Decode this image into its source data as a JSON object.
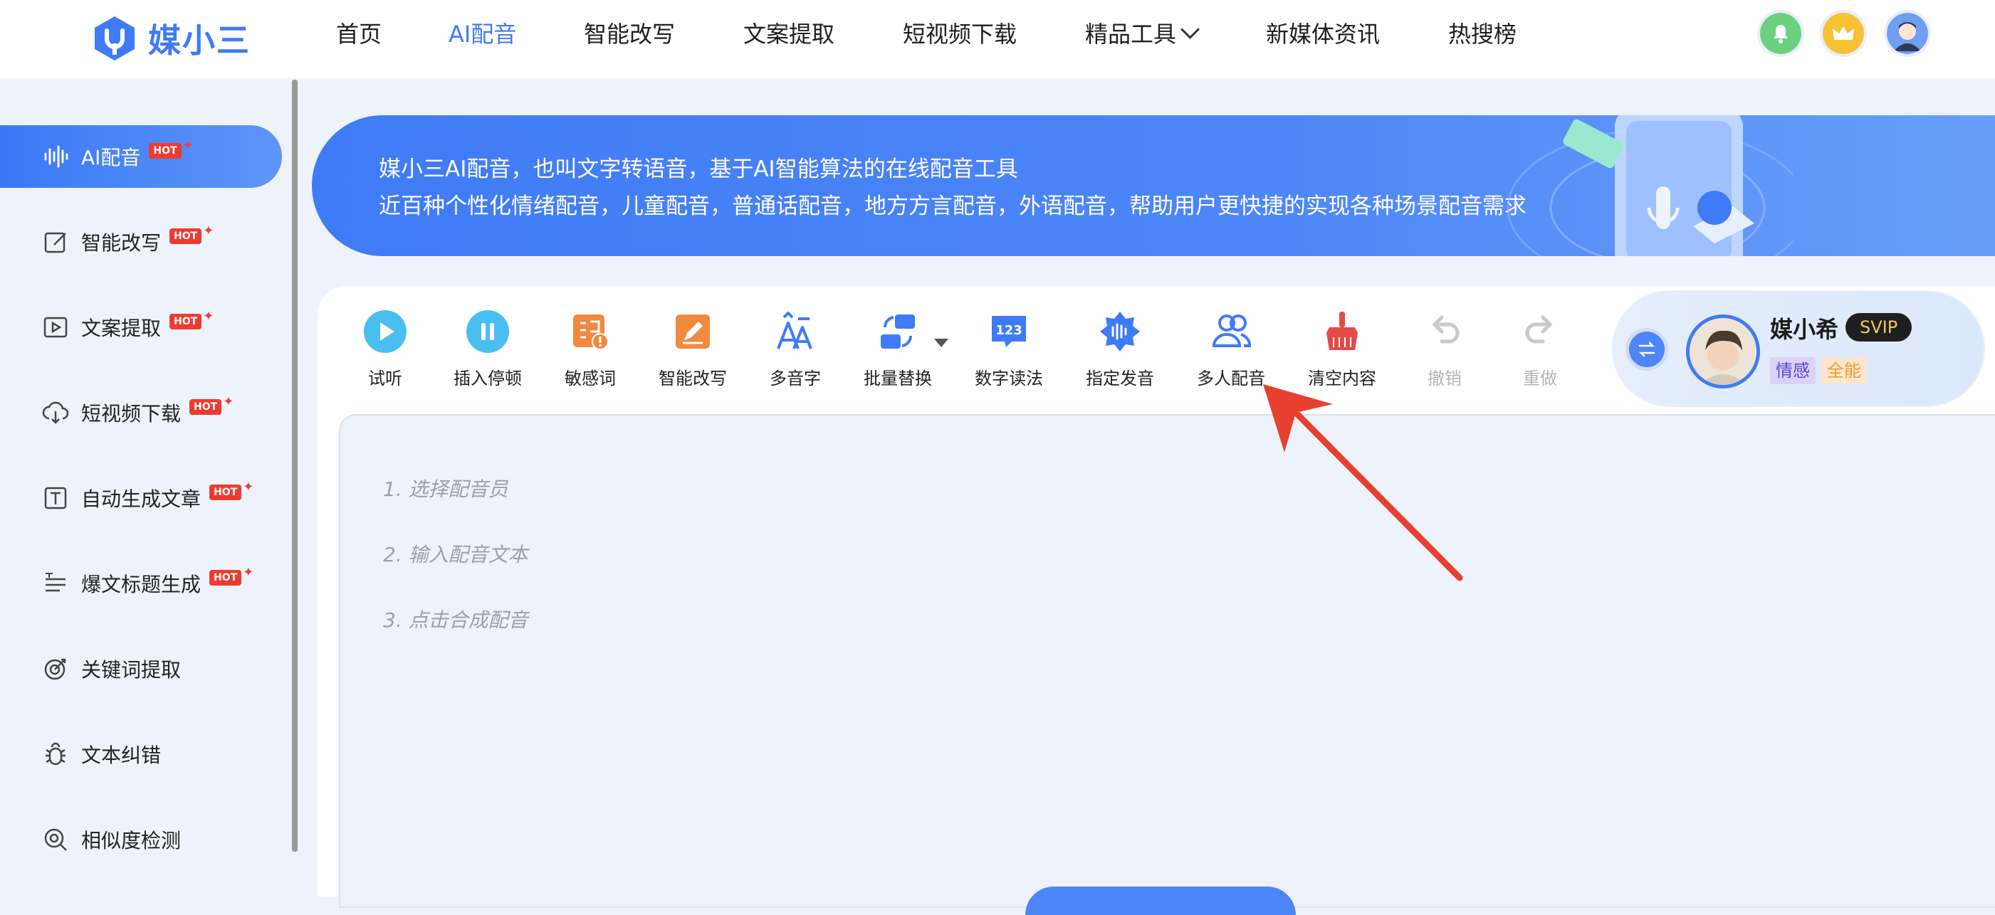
{
  "header": {
    "logo_text": "媒小三",
    "nav": [
      {
        "label": "首页",
        "active": false
      },
      {
        "label": "AI配音",
        "active": true
      },
      {
        "label": "智能改写",
        "active": false
      },
      {
        "label": "文案提取",
        "active": false
      },
      {
        "label": "短视频下载",
        "active": false
      },
      {
        "label": "精品工具",
        "active": false,
        "has_dropdown": true
      },
      {
        "label": "新媒体资讯",
        "active": false
      },
      {
        "label": "热搜榜",
        "active": false
      }
    ],
    "icons": [
      "bell-icon",
      "crown-icon",
      "avatar"
    ]
  },
  "sidebar": {
    "hot_label": "HOT",
    "items": [
      {
        "label": "AI配音",
        "icon": "waveform-icon",
        "hot": true,
        "active": true
      },
      {
        "label": "智能改写",
        "icon": "edit-icon",
        "hot": true
      },
      {
        "label": "文案提取",
        "icon": "video-extract-icon",
        "hot": true
      },
      {
        "label": "短视频下载",
        "icon": "cloud-download-icon",
        "hot": true
      },
      {
        "label": "自动生成文章",
        "icon": "text-icon",
        "hot": true
      },
      {
        "label": "爆文标题生成",
        "icon": "title-icon",
        "hot": true
      },
      {
        "label": "关键词提取",
        "icon": "target-icon",
        "hot": false
      },
      {
        "label": "文本纠错",
        "icon": "bug-icon",
        "hot": false
      },
      {
        "label": "相似度检测",
        "icon": "similarity-icon",
        "hot": false
      }
    ]
  },
  "banner": {
    "line1": "媒小三AI配音，也叫文字转语音，基于AI智能算法的在线配音工具",
    "line2": "近百种个性化情绪配音，儿童配音，普通话配音，地方方言配音，外语配音，帮助用户更快捷的实现各种场景配音需求"
  },
  "toolbar": {
    "tools": [
      {
        "label": "试听",
        "icon": "play-icon"
      },
      {
        "label": "插入停顿",
        "icon": "pause-icon"
      },
      {
        "label": "敏感词",
        "icon": "sensitive-word-icon"
      },
      {
        "label": "智能改写",
        "icon": "smart-rewrite-icon"
      },
      {
        "label": "多音字",
        "icon": "polyphone-icon"
      },
      {
        "label": "批量替换",
        "icon": "batch-replace-icon"
      },
      {
        "label": "数字读法",
        "icon": "number-reading-icon"
      },
      {
        "label": "指定发音",
        "icon": "pronunciation-icon"
      },
      {
        "label": "多人配音",
        "icon": "multi-person-icon"
      },
      {
        "label": "清空内容",
        "icon": "broom-icon"
      },
      {
        "label": "撤销",
        "icon": "undo-icon",
        "disabled": true
      },
      {
        "label": "重做",
        "icon": "redo-icon",
        "disabled": true
      }
    ]
  },
  "editor": {
    "hints": [
      "1. 选择配音员",
      "2. 输入配音文本",
      "3. 点击合成配音"
    ]
  },
  "voice": {
    "name": "媒小希",
    "badge": "SVIP",
    "tags": [
      "情感",
      "全能"
    ]
  },
  "colors": {
    "accent": "#3f7bf6",
    "hot": "#ee3b2f",
    "annotation_arrow": "#e8402e"
  }
}
